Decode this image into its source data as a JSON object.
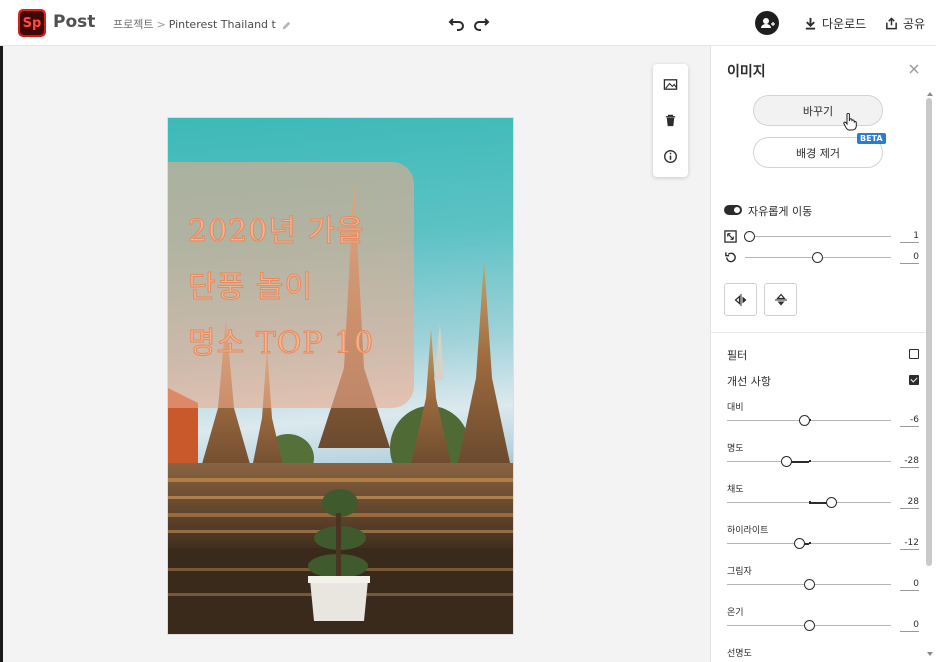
{
  "app": {
    "logo_text": "Sp",
    "name": "Post"
  },
  "breadcrumb": {
    "parent": "프로젝트",
    "separator": ">",
    "title": "Pinterest Thailand t"
  },
  "header": {
    "download_label": "다운로드",
    "share_label": "공유"
  },
  "poster": {
    "headline_lines": [
      "2020년 가을",
      "단풍 놀이",
      "명소 TOP 10"
    ],
    "accent_color": "#f4b48e"
  },
  "panel": {
    "title": "이미지",
    "replace_label": "바꾸기",
    "remove_bg_label": "배경 제거",
    "beta_badge": "BETA",
    "free_move_label": "자유롭게 이동",
    "scale_value": "1",
    "rotate_value": "0",
    "filter_label": "필터",
    "enhance_label": "개선 사항",
    "filter_checked": false,
    "enhance_checked": true,
    "adjustments": [
      {
        "label": "대비",
        "value": "-6",
        "level": -6
      },
      {
        "label": "명도",
        "value": "-28",
        "level": -28
      },
      {
        "label": "채도",
        "value": "28",
        "level": 28
      },
      {
        "label": "하이라이트",
        "value": "-12",
        "level": -12
      },
      {
        "label": "그림자",
        "value": "0",
        "level": 0
      },
      {
        "label": "온기",
        "value": "0",
        "level": 0
      },
      {
        "label": "선명도",
        "value": "",
        "level": 0
      }
    ]
  }
}
